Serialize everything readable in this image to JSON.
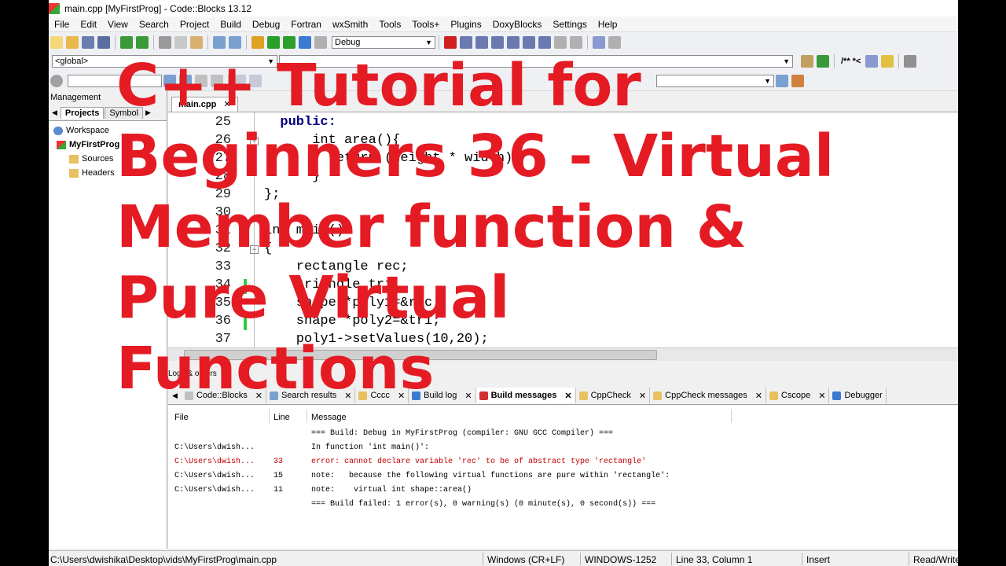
{
  "window": {
    "title": "main.cpp [MyFirstProg] - Code::Blocks 13.12"
  },
  "menu": [
    "File",
    "Edit",
    "View",
    "Search",
    "Project",
    "Build",
    "Debug",
    "Fortran",
    "wxSmith",
    "Tools",
    "Tools+",
    "Plugins",
    "DoxyBlocks",
    "Settings",
    "Help"
  ],
  "toolbar": {
    "build_target": "Debug",
    "scope": "<global>",
    "doxy_comment": "/** *<"
  },
  "management": {
    "title": "Management",
    "tabs": [
      "Projects",
      "Symbol"
    ],
    "tree": {
      "workspace": "Workspace",
      "project": "MyFirstProg",
      "sources": "Sources",
      "headers": "Headers"
    }
  },
  "editor": {
    "tab": "main.cpp",
    "lines": [
      {
        "n": "25",
        "text": "  public:"
      },
      {
        "n": "26",
        "text": "      int area(){"
      },
      {
        "n": "27",
        "text": "        return (height * width);"
      },
      {
        "n": "28",
        "text": "      }"
      },
      {
        "n": "29",
        "text": "};"
      },
      {
        "n": "30",
        "text": ""
      },
      {
        "n": "31",
        "text": "int main()"
      },
      {
        "n": "32",
        "text": "{"
      },
      {
        "n": "33",
        "text": "    rectangle rec;"
      },
      {
        "n": "34",
        "text": "    triangle tri;"
      },
      {
        "n": "35",
        "text": "    shape *poly1=&rec;"
      },
      {
        "n": "36",
        "text": "    shape *poly2=&tri;"
      },
      {
        "n": "37",
        "text": "    poly1->setValues(10,20);"
      }
    ]
  },
  "logs": {
    "title": "Logs & others",
    "tabs": [
      "Code::Blocks",
      "Search results",
      "Cccc",
      "Build log",
      "Build messages",
      "CppCheck",
      "CppCheck messages",
      "Cscope",
      "Debugger"
    ],
    "columns": [
      "File",
      "Line",
      "Message"
    ],
    "rows": [
      {
        "file": "",
        "line": "",
        "message": "=== Build: Debug in MyFirstProg (compiler: GNU GCC Compiler) ==="
      },
      {
        "file": "C:\\Users\\dwish...",
        "line": "",
        "message": "In function 'int main()':"
      },
      {
        "file": "C:\\Users\\dwish...",
        "line": "33",
        "message": "error: cannot declare variable 'rec' to be of abstract type 'rectangle'"
      },
      {
        "file": "C:\\Users\\dwish...",
        "line": "15",
        "message": "note:   because the following virtual functions are pure within 'rectangle':"
      },
      {
        "file": "C:\\Users\\dwish...",
        "line": "11",
        "message": "note:    virtual int shape::area()"
      },
      {
        "file": "",
        "line": "",
        "message": "=== Build failed: 1 error(s), 0 warning(s) (0 minute(s), 0 second(s)) ==="
      }
    ]
  },
  "status": {
    "path": "C:\\Users\\dwishika\\Desktop\\vids\\MyFirstProg\\main.cpp",
    "eol": "Windows (CR+LF)",
    "encoding": "WINDOWS-1252",
    "position": "Line 33, Column 1",
    "mode": "Insert",
    "access": "Read/Write"
  },
  "overlay_title": [
    "C++ Tutorial for",
    "Beginners 36 - Virtual",
    "Member function &",
    "Pure Virtual",
    "Functions"
  ]
}
